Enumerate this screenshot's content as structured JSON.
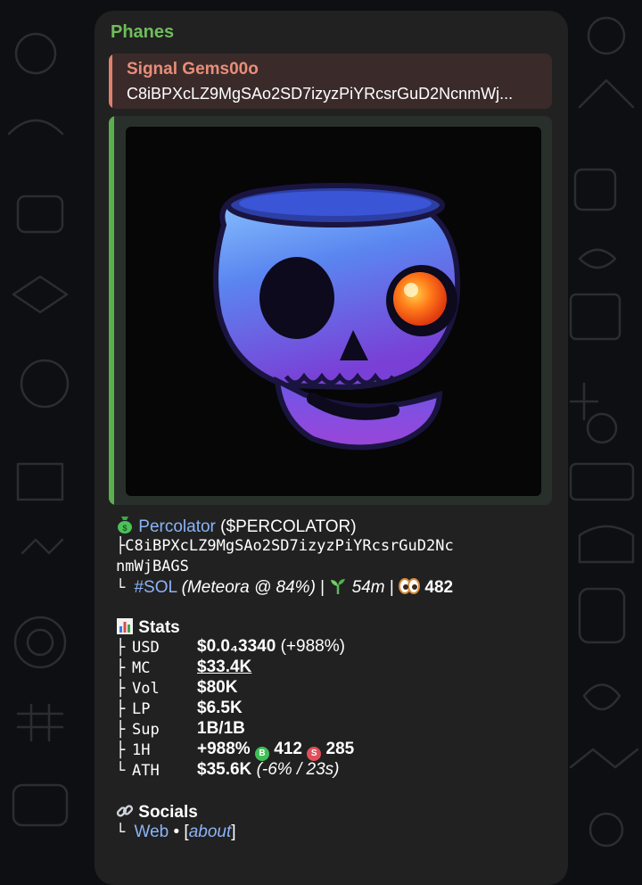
{
  "message": {
    "sender": "Phanes",
    "reply": {
      "title": "Signal Gems00o",
      "text": "C8iBPXcLZ9MgSAo2SD7izyzPiYRcsrGuD2NcnmWj..."
    },
    "token": {
      "name": "Percolator",
      "ticker": "($PERCOLATOR)",
      "address_line1": "C8iBPXcLZ9MgSAo2SD7izyzPiYRcsrGuD2Nc",
      "address_line2": "nmWjBAGS",
      "chain_tag": "#SOL",
      "dex_prefix": "(Meteora @ ",
      "dex_percent": "84%",
      "dex_suffix": ")",
      "age": "54m",
      "holders": "482"
    },
    "stats": {
      "title": "Stats",
      "rows": [
        {
          "label": "USD",
          "value": "$0.0₄3340",
          "extra": "(+988%)"
        },
        {
          "label": "MC",
          "value": "$33.4K"
        },
        {
          "label": "Vol",
          "value": "$80K"
        },
        {
          "label": "LP",
          "value": "$6.5K"
        },
        {
          "label": "Sup",
          "value": "1B/1B"
        },
        {
          "label": "1H",
          "value": "+988%",
          "buys": "412",
          "sells": "285"
        },
        {
          "label": "ATH",
          "value": "$35.6K",
          "extra": "(-6% / 23s)"
        }
      ]
    },
    "socials": {
      "title": "Socials",
      "web": "Web",
      "separator": " • [",
      "about": "about",
      "close": "]"
    }
  },
  "colors": {
    "sender": "#6fbd5c",
    "reply_accent": "#e0806b",
    "media_accent": "#5ab04c",
    "link": "#8ab4f8",
    "buy": "#3fbf55",
    "sell": "#e0505a"
  },
  "icons": {
    "token": "money-bag-icon",
    "age": "seedling-icon",
    "holders": "eyes-icon",
    "stats": "bar-chart-icon",
    "socials": "link-icon"
  }
}
